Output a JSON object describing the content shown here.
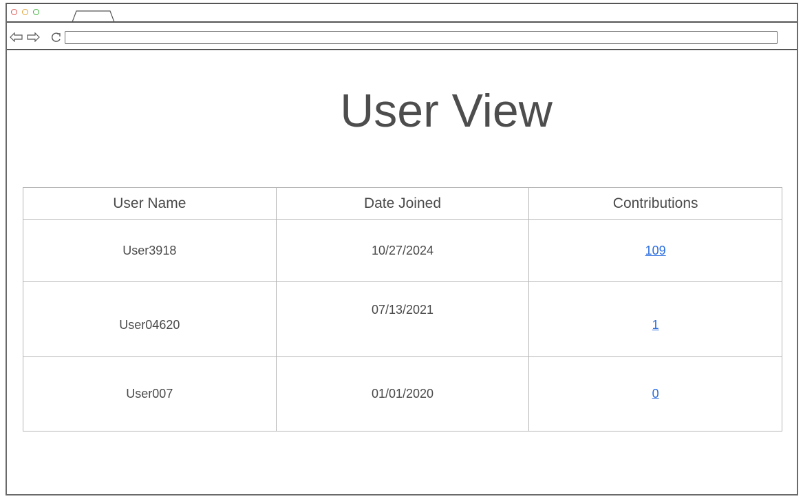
{
  "browser": {
    "address_value": "",
    "controls": [
      "close-dot",
      "minimize-dot",
      "maximize-dot"
    ]
  },
  "page": {
    "title": "User View"
  },
  "table": {
    "headers": [
      "User Name",
      "Date Joined",
      "Contributions"
    ],
    "rows": [
      {
        "user_name": "User3918",
        "date_joined": "10/27/2024",
        "contributions": "109"
      },
      {
        "user_name": "User04620",
        "date_joined": "07/13/2021",
        "contributions": "1"
      },
      {
        "user_name": "User007",
        "date_joined": "01/01/2020",
        "contributions": "0"
      }
    ]
  },
  "colors": {
    "link": "#2a6de0",
    "text": "#4a4a4a",
    "border": "#b5b5b5",
    "close": "#d9534f",
    "minimize": "#e0a030",
    "maximize": "#3cae3c"
  },
  "icons": [
    "back-arrow-icon",
    "forward-arrow-icon",
    "reload-icon"
  ]
}
